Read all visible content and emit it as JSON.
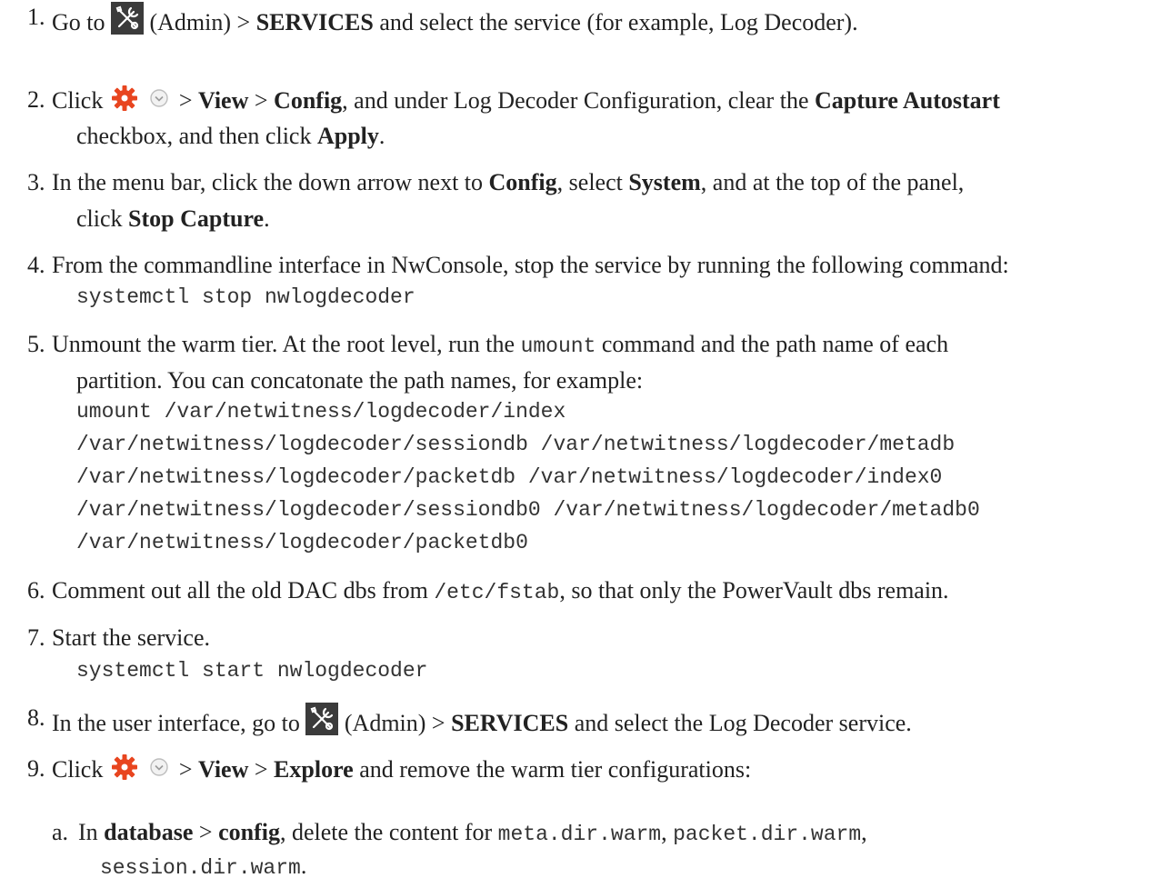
{
  "steps": [
    {
      "num": "1.",
      "lines": [
        {
          "t1": "Go to ",
          "t2": " (Admin) > ",
          "b1": "SERVICES",
          "t3": " and select the service (for example, Log Decoder)."
        }
      ]
    },
    {
      "num": "2.",
      "l1": {
        "t1": "Click ",
        "t2": " > ",
        "b1": "View",
        "t3": " > ",
        "b2": "Config",
        "t4": ", and under Log Decoder Configuration, clear the ",
        "b3": "Capture Autostart"
      },
      "l2": {
        "t1": "checkbox, and then click ",
        "b1": "Apply",
        "t2": "."
      }
    },
    {
      "num": "3.",
      "l1": {
        "t1": "In the menu bar, click the down arrow next to ",
        "b1": "Config",
        "t2": ", select ",
        "b2": "System",
        "t3": ", and at the top of the panel,"
      },
      "l2": {
        "t1": "click ",
        "b1": "Stop Capture",
        "t2": "."
      }
    },
    {
      "num": "4.",
      "l1": "From the commandline interface in NwConsole, stop the service by running the following command:",
      "code": "systemctl stop nwlogdecoder"
    },
    {
      "num": "5.",
      "l1": {
        "t1": "Unmount the warm tier. At the root level, run the ",
        "m1": "umount",
        "t2": " command and the path name of each"
      },
      "l2": "partition. You can concatonate the path names, for example:",
      "code": [
        "umount /var/netwitness/logdecoder/index",
        "/var/netwitness/logdecoder/sessiondb /var/netwitness/logdecoder/metadb",
        "/var/netwitness/logdecoder/packetdb /var/netwitness/logdecoder/index0",
        "/var/netwitness/logdecoder/sessiondb0 /var/netwitness/logdecoder/metadb0",
        "/var/netwitness/logdecoder/packetdb0"
      ]
    },
    {
      "num": "6.",
      "l1": {
        "t1": "Comment out all the old DAC dbs from ",
        "m1": "/etc/fstab",
        "t2": ", so that only the PowerVault dbs remain."
      }
    },
    {
      "num": "7.",
      "l1": "Start the service.",
      "code": "systemctl start nwlogdecoder"
    },
    {
      "num": "8.",
      "l1": {
        "t1": "In the user interface, go to ",
        "t2": " (Admin) > ",
        "b1": "SERVICES",
        "t3": " and select the Log Decoder service."
      }
    },
    {
      "num": "9.",
      "l1": {
        "t1": "Click ",
        "t2": " > ",
        "b1": "View",
        "t3": " > ",
        "b2": "Explore",
        "t4": " and remove the warm tier configurations:"
      }
    },
    {
      "num": "a.",
      "l1": {
        "t1": "In ",
        "b1": "database",
        "t2": " > ",
        "b2": "config",
        "t3": ", delete the content for ",
        "m1": "meta.dir.warm",
        "t4": ", ",
        "m2": "packet.dir.warm",
        "t5": ","
      },
      "l2": {
        "m1": "session.dir.warm",
        "t1": "."
      }
    }
  ],
  "icons": {
    "admin": "admin-tools-icon",
    "gear": "gear-icon",
    "dropdown": "chevron-down-circle-icon"
  },
  "colors": {
    "gear": "#e8451f",
    "admin_bg": "#3b3b3b"
  }
}
